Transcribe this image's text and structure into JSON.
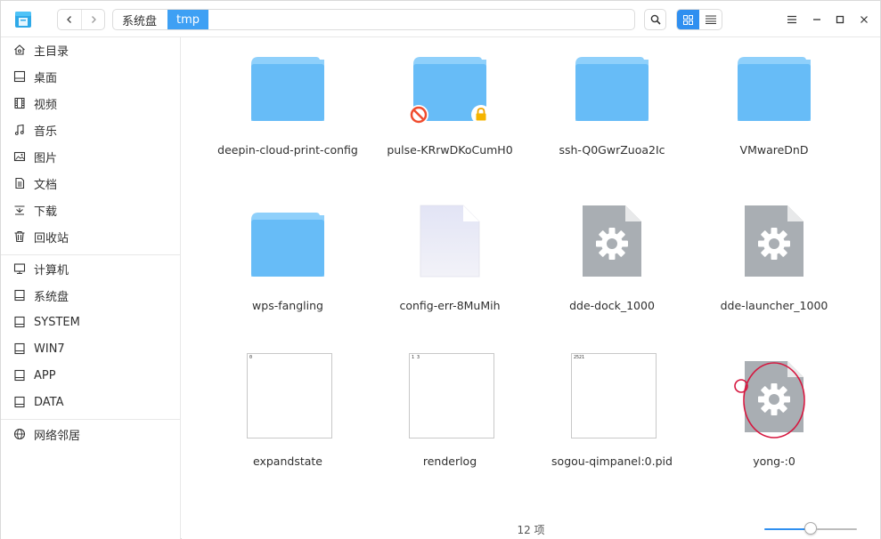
{
  "titlebar": {
    "breadcrumbs": [
      "系统盘",
      "tmp"
    ],
    "icons": {
      "app": "file-manager-icon",
      "back": "chevron-left-icon",
      "forward": "chevron-right-icon",
      "search": "search-icon",
      "grid_view": "grid-view-icon",
      "list_view": "list-view-icon",
      "menu": "hamburger-menu-icon",
      "minimize": "minimize-icon",
      "maximize": "maximize-icon",
      "close": "close-icon"
    },
    "active_view": "grid"
  },
  "sidebar": {
    "places": [
      {
        "label": "主目录",
        "icon": "home-icon"
      },
      {
        "label": "桌面",
        "icon": "desktop-icon"
      },
      {
        "label": "视频",
        "icon": "video-icon"
      },
      {
        "label": "音乐",
        "icon": "music-icon"
      },
      {
        "label": "图片",
        "icon": "picture-icon"
      },
      {
        "label": "文档",
        "icon": "document-icon"
      },
      {
        "label": "下载",
        "icon": "download-icon"
      },
      {
        "label": "回收站",
        "icon": "trash-icon"
      }
    ],
    "devices": [
      {
        "label": "计算机",
        "icon": "computer-icon"
      },
      {
        "label": "系统盘",
        "icon": "disk-icon"
      },
      {
        "label": "SYSTEM",
        "icon": "disk-icon"
      },
      {
        "label": "WIN7",
        "icon": "disk-icon"
      },
      {
        "label": "APP",
        "icon": "disk-icon"
      },
      {
        "label": "DATA",
        "icon": "disk-icon"
      }
    ],
    "network": [
      {
        "label": "网络邻居",
        "icon": "network-icon"
      }
    ]
  },
  "files": [
    {
      "name": "deepin-cloud-print-config",
      "kind": "folder"
    },
    {
      "name": "pulse-KRrwDKoCumH0",
      "kind": "folder-locked",
      "emblems": [
        "no-access-icon",
        "lock-icon"
      ]
    },
    {
      "name": "ssh-Q0GwrZuoa2Ic",
      "kind": "folder"
    },
    {
      "name": "VMwareDnD",
      "kind": "folder"
    },
    {
      "name": "wps-fangling",
      "kind": "folder"
    },
    {
      "name": "config-err-8MuMih",
      "kind": "blank-file"
    },
    {
      "name": "dde-dock_1000",
      "kind": "executable"
    },
    {
      "name": "dde-launcher_1000",
      "kind": "executable"
    },
    {
      "name": "expandstate",
      "kind": "text",
      "preview": "0"
    },
    {
      "name": "renderlog",
      "kind": "text",
      "preview": "1 3"
    },
    {
      "name": "sogou-qimpanel:0.pid",
      "kind": "text",
      "preview": "2521"
    },
    {
      "name": "yong-:0",
      "kind": "executable"
    }
  ],
  "status": {
    "count_text": "12 项",
    "zoom_level": 0.5
  },
  "colors": {
    "accent": "#2f8ff0",
    "folder": "#67bcf7",
    "folder_tab": "#8fd0fb",
    "exec_gray": "#a9aeb3",
    "annotation_red": "#d6173f"
  }
}
